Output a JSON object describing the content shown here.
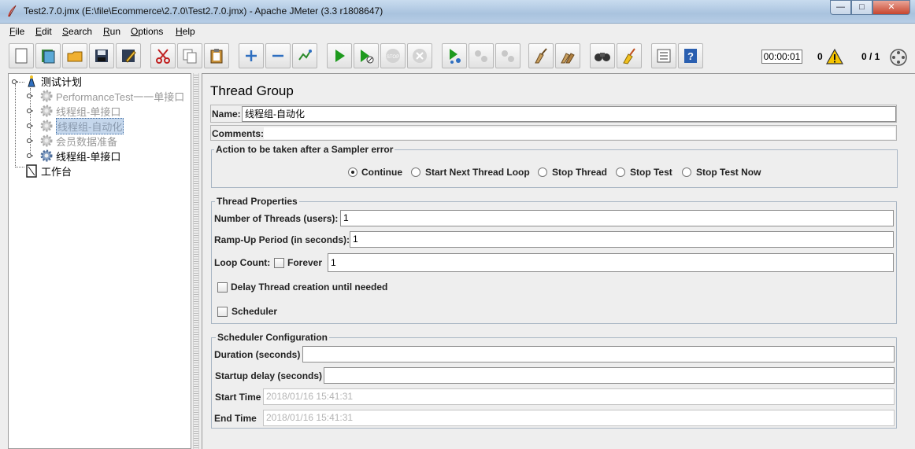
{
  "window": {
    "title": "Test2.7.0.jmx (E:\\file\\Ecommerce\\2.7.0\\Test2.7.0.jmx) - Apache JMeter (3.3 r1808647)",
    "min_label": "—",
    "max_label": "□",
    "close_label": "✕"
  },
  "menu": [
    "File",
    "Edit",
    "Search",
    "Run",
    "Options",
    "Help"
  ],
  "toolbar": {
    "icons": [
      "new-icon",
      "templates-icon",
      "open-icon",
      "save-icon",
      "save-as-icon",
      "cut-icon",
      "copy-icon",
      "paste-icon",
      "expand-icon",
      "collapse-icon",
      "toggle-icon",
      "start-icon",
      "start-no-pause-icon",
      "stop-icon",
      "shutdown-icon",
      "remote-start-icon",
      "remote-stop-icon",
      "remote-shutdown-icon",
      "clear-icon",
      "clear-all-icon",
      "search-icon",
      "reset-search-icon",
      "function-helper-icon",
      "help-icon"
    ],
    "elapsed": "00:00:01",
    "error_count": "0",
    "threads": "0 / 1"
  },
  "tree": {
    "root": "测试计划",
    "items": [
      {
        "label": "PerformanceTest一一单接口",
        "state": "disabled"
      },
      {
        "label": "线程组-单接口",
        "state": "disabled"
      },
      {
        "label": "线程组-自动化",
        "state": "selected"
      },
      {
        "label": "会员数据准备",
        "state": "disabled"
      },
      {
        "label": "线程组-单接口",
        "state": "enabled"
      }
    ],
    "workbench": "工作台"
  },
  "panel": {
    "title": "Thread Group",
    "name_label": "Name:",
    "name_value": "线程组-自动化",
    "comments_label": "Comments:",
    "sampler_error": {
      "title": "Action to be taken after a Sampler error",
      "options": [
        "Continue",
        "Start Next Thread Loop",
        "Stop Thread",
        "Stop Test",
        "Stop Test Now"
      ],
      "selected": "Continue"
    },
    "thread_props": {
      "title": "Thread Properties",
      "threads_label": "Number of Threads (users):",
      "threads_value": "1",
      "rampup_label": "Ramp-Up Period (in seconds):",
      "rampup_value": "1",
      "loop_label": "Loop Count:",
      "forever_label": "Forever",
      "loop_value": "1",
      "delay_label": "Delay Thread creation until needed",
      "scheduler_label": "Scheduler"
    },
    "scheduler": {
      "title": "Scheduler Configuration",
      "duration_label": "Duration (seconds)",
      "duration_value": "",
      "startup_label": "Startup delay (seconds)",
      "startup_value": "",
      "start_label": "Start Time",
      "start_value": "2018/01/16 15:41:31",
      "end_label": "End Time",
      "end_value": "2018/01/16 15:41:31"
    }
  },
  "colors": {
    "selection": "#c5d7ec",
    "play_green": "#1e9a1e",
    "warning_yellow": "#f5c400"
  }
}
